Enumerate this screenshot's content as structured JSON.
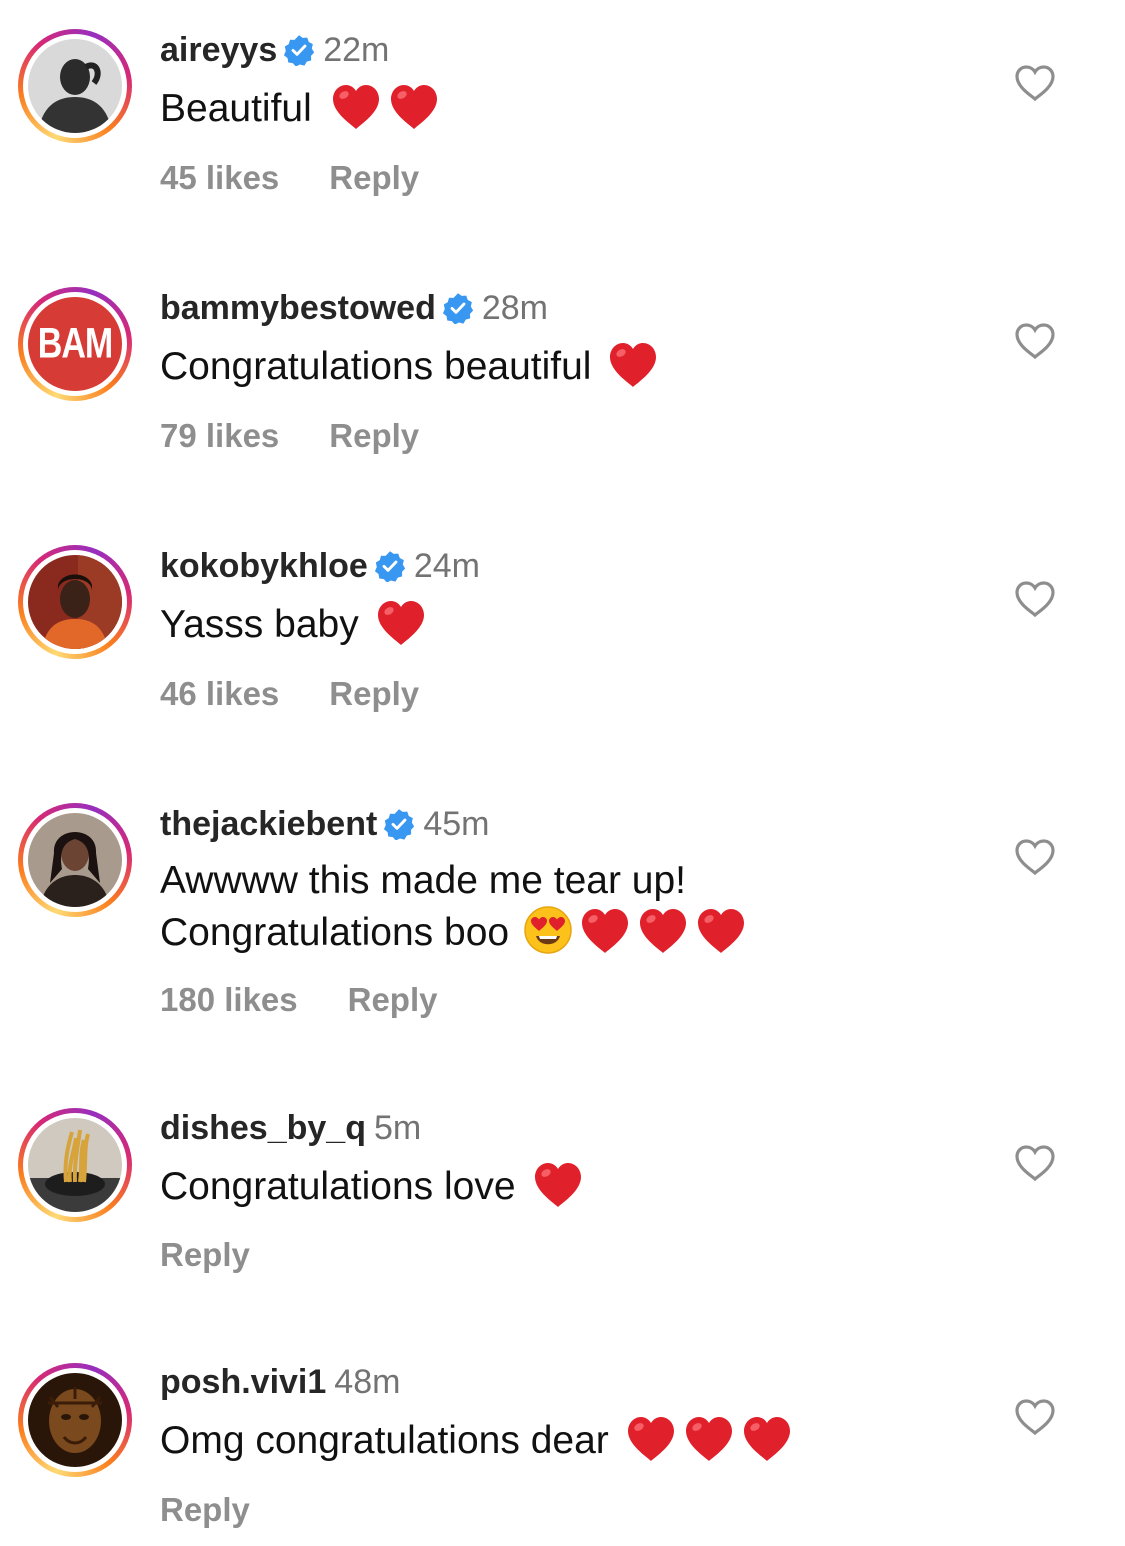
{
  "comments": [
    {
      "username": "aireyys",
      "verified": true,
      "time": "22m",
      "text": "Beautiful",
      "hearts": 2,
      "likes": "45 likes",
      "reply": "Reply"
    },
    {
      "username": "bammybestowed",
      "verified": true,
      "time": "28m",
      "text": "Congratulations beautiful",
      "hearts": 1,
      "likes": "79 likes",
      "reply": "Reply",
      "avatar_text": "BAM"
    },
    {
      "username": "kokobykhloe",
      "verified": true,
      "time": "24m",
      "text": "Yasss baby",
      "hearts": 1,
      "likes": "46 likes",
      "reply": "Reply"
    },
    {
      "username": "thejackiebent",
      "verified": true,
      "time": "45m",
      "text_line1": "Awwww this made me tear up!",
      "text_line2": "Congratulations boo",
      "hearts": 3,
      "likes": "180 likes",
      "reply": "Reply"
    },
    {
      "username": "dishes_by_q",
      "verified": false,
      "time": "5m",
      "text": "Congratulations love",
      "hearts": 1,
      "reply": "Reply"
    },
    {
      "username": "posh.vivi1",
      "verified": false,
      "time": "48m",
      "text": "Omg congratulations dear",
      "hearts": 3,
      "reply": "Reply"
    }
  ],
  "icons": {
    "verified": "verified-badge-icon",
    "like": "heart-outline-icon",
    "emoji_heart": "red-heart-emoji",
    "emoji_face": "heart-eyes-emoji"
  },
  "colors": {
    "verified_blue": "#3897f0",
    "meta_gray": "#8e8e8e",
    "heart_red": "#e0202a",
    "bam_red": "#d63c35"
  }
}
